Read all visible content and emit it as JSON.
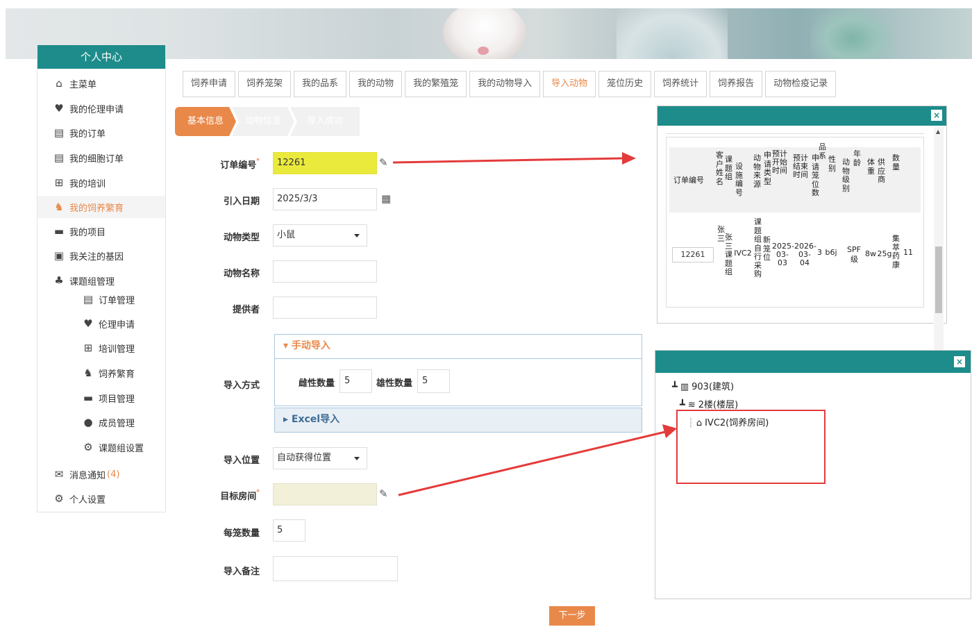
{
  "sidebar": {
    "title": "个人中心",
    "items": [
      {
        "label": "主菜单",
        "icon": "home-icon",
        "glyph": "⌂"
      },
      {
        "label": "我的伦理申请",
        "icon": "heart-hand-icon",
        "glyph": "♥"
      },
      {
        "label": "我的订单",
        "icon": "clipboard-icon",
        "glyph": "▤"
      },
      {
        "label": "我的细胞订单",
        "icon": "clipboard-icon",
        "glyph": "▤"
      },
      {
        "label": "我的培训",
        "icon": "training-icon",
        "glyph": "⊞"
      },
      {
        "label": "我的饲养繁育",
        "icon": "animal-icon",
        "glyph": "♞",
        "active": true
      },
      {
        "label": "我的项目",
        "icon": "bars-icon",
        "glyph": "▬"
      },
      {
        "label": "我关注的基因",
        "icon": "monitor-icon",
        "glyph": "▣"
      },
      {
        "label": "课题组管理",
        "icon": "org-icon",
        "glyph": "♣"
      },
      {
        "label": "订单管理",
        "icon": "clipboard-icon",
        "glyph": "▤",
        "sub": true
      },
      {
        "label": "伦理申请",
        "icon": "heart-hand-icon",
        "glyph": "♥",
        "sub": true
      },
      {
        "label": "培训管理",
        "icon": "training-icon",
        "glyph": "⊞",
        "sub": true
      },
      {
        "label": "饲养繁育",
        "icon": "animal-icon",
        "glyph": "♞",
        "sub": true
      },
      {
        "label": "项目管理",
        "icon": "bars-icon",
        "glyph": "▬",
        "sub": true
      },
      {
        "label": "成员管理",
        "icon": "user-icon",
        "glyph": "●",
        "sub": true
      },
      {
        "label": "课题组设置",
        "icon": "gear-icon",
        "glyph": "⚙",
        "sub": true
      },
      {
        "label": "消息通知",
        "icon": "mail-icon",
        "glyph": "✉",
        "count": "(4)"
      },
      {
        "label": "个人设置",
        "icon": "gear-icon",
        "glyph": "⚙"
      }
    ]
  },
  "tabs": [
    "饲养申请",
    "饲养笼架",
    "我的品系",
    "我的动物",
    "我的繁殖笼",
    "我的动物导入",
    "导入动物",
    "笼位历史",
    "饲养统计",
    "饲养报告",
    "动物检疫记录"
  ],
  "active_tab": "导入动物",
  "steps": [
    "基本信息",
    "动物信息",
    "导入成功"
  ],
  "form": {
    "order_no_label": "订单编号",
    "order_no": "12261",
    "date_label": "引入日期",
    "date": "2025/3/3",
    "animal_type_label": "动物类型",
    "animal_type": "小鼠",
    "animal_name_label": "动物名称",
    "animal_name": "",
    "provider_label": "提供者",
    "provider": "",
    "import_method_label": "导入方式",
    "manual_import": "手动导入",
    "female_label": "雌性数量",
    "female_count": "5",
    "male_label": "雄性数量",
    "male_count": "5",
    "excel_import": "Excel导入",
    "location_label": "导入位置",
    "location": "自动获得位置",
    "target_room_label": "目标房间",
    "target_room": "",
    "per_cage_label": "每笼数量",
    "per_cage": "5",
    "remark_label": "导入备注",
    "remark": "",
    "next_button": "下一步"
  },
  "order_popup": {
    "close": "×",
    "headers": [
      "订单编号",
      "客户姓名",
      "课题组",
      "设施编号",
      "动物来源",
      "申请类型",
      "预计开始时间",
      "预计结束时间",
      "申请笼位数",
      "品系",
      "性别",
      "动物级别",
      "年龄",
      "体重",
      "供应商",
      "数量"
    ],
    "row": {
      "order_no": "12261",
      "customer": "张三",
      "group": "张三课题组",
      "facility": "IVC2",
      "source": "课题组自行采购",
      "apply_type": "新笼位",
      "start": "2025-03-03",
      "end": "2026-03-04",
      "cages": "3",
      "strain": "b6j",
      "sex": "SPF",
      "level": "级",
      "age": "8w",
      "weight": "25g",
      "supplier": "集萃药康",
      "qty": "11"
    }
  },
  "room_popup": {
    "close": "×",
    "tree": [
      {
        "label": "903(建筑)",
        "icon": "building-icon"
      },
      {
        "label": "2楼(楼层)",
        "icon": "layers-icon"
      },
      {
        "label": "IVC2(饲养房间)",
        "icon": "home-icon"
      }
    ]
  },
  "colors": {
    "teal": "#1d8c8a",
    "orange": "#e8894a",
    "red": "#e43b3b"
  }
}
